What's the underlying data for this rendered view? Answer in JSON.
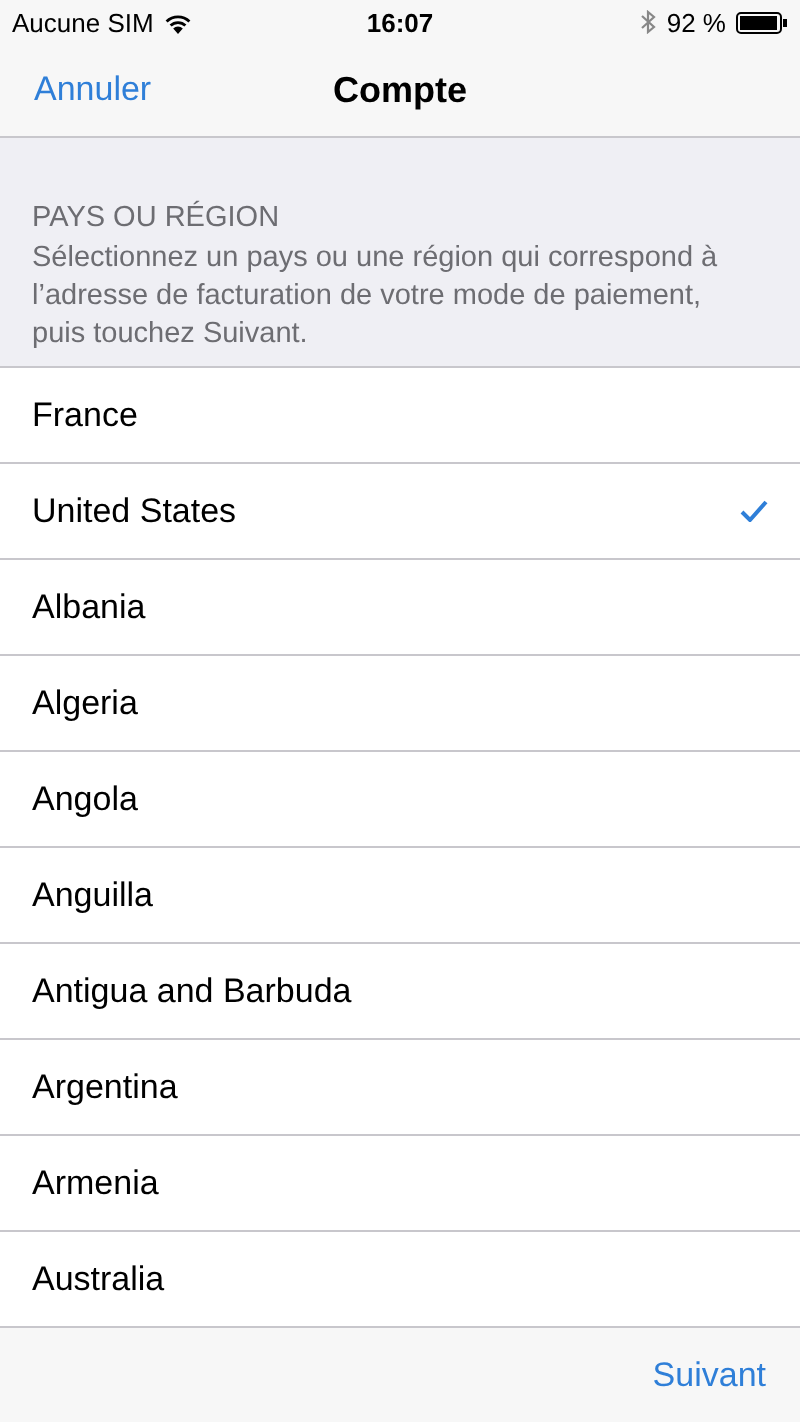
{
  "status_bar": {
    "carrier": "Aucune SIM",
    "time": "16:07",
    "battery": "92 %"
  },
  "nav": {
    "cancel": "Annuler",
    "title": "Compte"
  },
  "section": {
    "header": "PAYS OU RÉGION",
    "description": "Sélectionnez un pays ou une région qui correspond à l’adresse de facturation de votre mode de paiement, puis touchez Suivant."
  },
  "countries": [
    {
      "name": "France",
      "selected": false
    },
    {
      "name": "United States",
      "selected": true
    },
    {
      "name": "Albania",
      "selected": false
    },
    {
      "name": "Algeria",
      "selected": false
    },
    {
      "name": "Angola",
      "selected": false
    },
    {
      "name": "Anguilla",
      "selected": false
    },
    {
      "name": "Antigua and Barbuda",
      "selected": false
    },
    {
      "name": "Argentina",
      "selected": false
    },
    {
      "name": "Armenia",
      "selected": false
    },
    {
      "name": "Australia",
      "selected": false
    }
  ],
  "toolbar": {
    "next": "Suivant"
  }
}
